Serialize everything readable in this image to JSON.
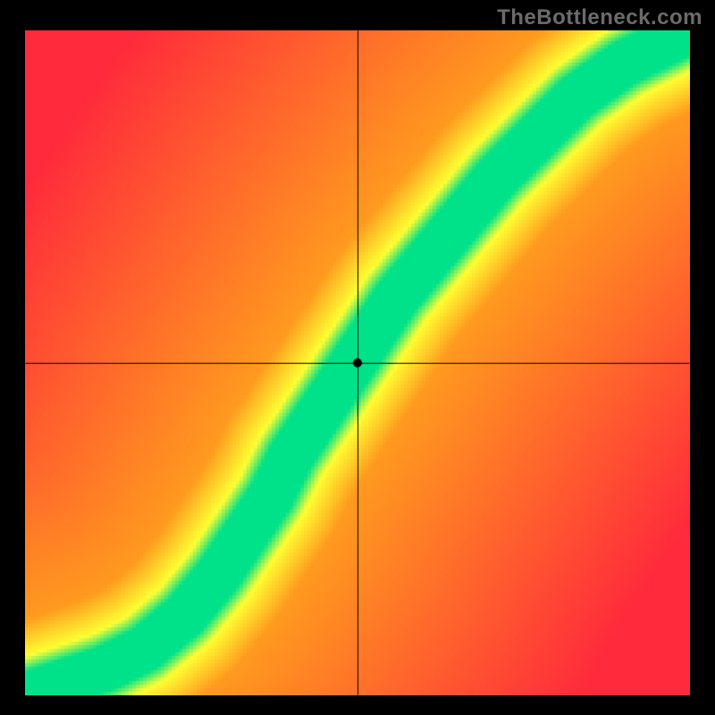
{
  "watermark": "TheBottleneck.com",
  "chart_data": {
    "type": "heatmap",
    "title": "",
    "xlabel": "",
    "ylabel": "",
    "xlim": [
      0,
      1
    ],
    "ylim": [
      0,
      1
    ],
    "marker": {
      "x": 0.5,
      "y": 0.5
    },
    "crosshair": {
      "x": 0.5,
      "y": 0.5
    },
    "colors": {
      "best": "#00e28a",
      "good": "#ffff33",
      "mid": "#ff9a1f",
      "bad": "#ff2a3c"
    },
    "ridge_description": "Curved optimal band running from lower-left corner up through center to upper-right; band starts with S-curve near origin, straight diagonal through middle, widens slightly in upper right.",
    "ridge_points": [
      {
        "x": 0.0,
        "y": 0.0
      },
      {
        "x": 0.06,
        "y": 0.02
      },
      {
        "x": 0.12,
        "y": 0.04
      },
      {
        "x": 0.18,
        "y": 0.07
      },
      {
        "x": 0.24,
        "y": 0.12
      },
      {
        "x": 0.29,
        "y": 0.18
      },
      {
        "x": 0.33,
        "y": 0.24
      },
      {
        "x": 0.37,
        "y": 0.3
      },
      {
        "x": 0.4,
        "y": 0.36
      },
      {
        "x": 0.44,
        "y": 0.42
      },
      {
        "x": 0.48,
        "y": 0.48
      },
      {
        "x": 0.52,
        "y": 0.54
      },
      {
        "x": 0.56,
        "y": 0.6
      },
      {
        "x": 0.61,
        "y": 0.66
      },
      {
        "x": 0.66,
        "y": 0.72
      },
      {
        "x": 0.71,
        "y": 0.78
      },
      {
        "x": 0.77,
        "y": 0.84
      },
      {
        "x": 0.83,
        "y": 0.9
      },
      {
        "x": 0.9,
        "y": 0.95
      },
      {
        "x": 1.0,
        "y": 1.0
      }
    ],
    "band_half_width": 0.055,
    "yellow_half_width": 0.11,
    "field_note": "Away from band, value grades smoothly through yellow then orange to red; extreme lower-right and upper-left corners are red."
  }
}
